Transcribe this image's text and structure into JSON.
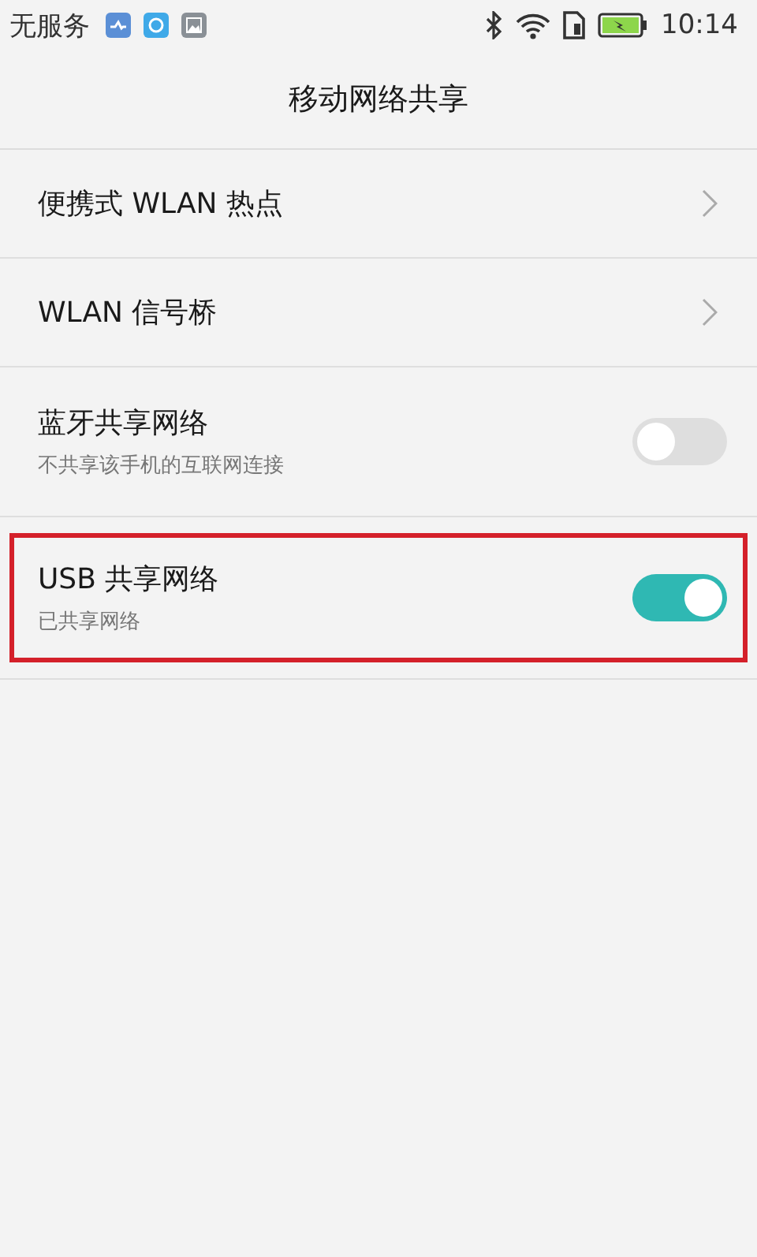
{
  "status_bar": {
    "carrier": "无服务",
    "time": "10:14"
  },
  "title": "移动网络共享",
  "items": [
    {
      "kind": "link",
      "title": "便携式 WLAN 热点",
      "highlighted": false
    },
    {
      "kind": "link",
      "title": "WLAN 信号桥",
      "highlighted": false
    },
    {
      "kind": "toggle",
      "title": "蓝牙共享网络",
      "subtitle": "不共享该手机的互联网连接",
      "on": false,
      "highlighted": false
    },
    {
      "kind": "toggle",
      "title": "USB 共享网络",
      "subtitle": "已共享网络",
      "on": true,
      "highlighted": true
    }
  ]
}
